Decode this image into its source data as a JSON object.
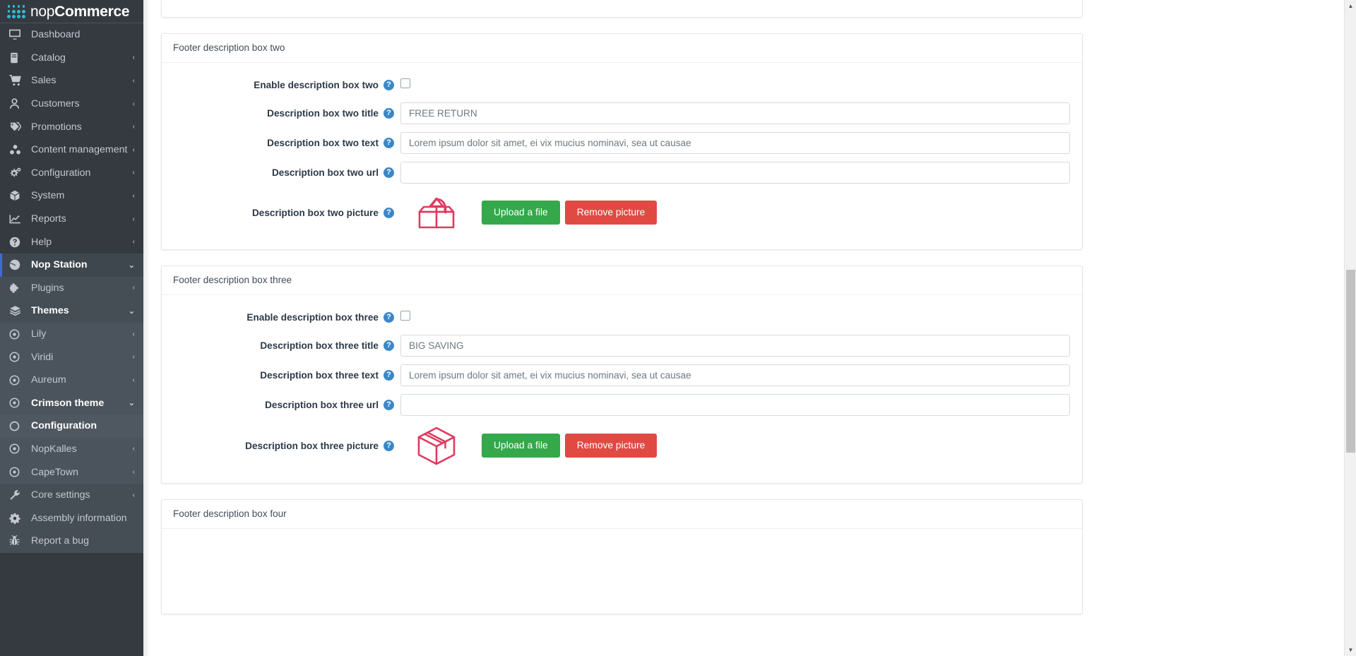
{
  "brand": {
    "name_light": "nop",
    "name_bold": "Commerce"
  },
  "sidebar": {
    "items": [
      {
        "label": "Dashboard",
        "icon": "dashboard-icon",
        "chevron": "",
        "level": 1,
        "state": "normal"
      },
      {
        "label": "Catalog",
        "icon": "catalog-icon",
        "chevron": "‹",
        "level": 1,
        "state": "normal"
      },
      {
        "label": "Sales",
        "icon": "cart-icon",
        "chevron": "‹",
        "level": 1,
        "state": "normal"
      },
      {
        "label": "Customers",
        "icon": "user-icon",
        "chevron": "‹",
        "level": 1,
        "state": "normal"
      },
      {
        "label": "Promotions",
        "icon": "tag-icon",
        "chevron": "‹",
        "level": 1,
        "state": "normal"
      },
      {
        "label": "Content management",
        "icon": "content-icon",
        "chevron": "‹",
        "level": 1,
        "state": "normal"
      },
      {
        "label": "Configuration",
        "icon": "gears-icon",
        "chevron": "‹",
        "level": 1,
        "state": "normal"
      },
      {
        "label": "System",
        "icon": "cube-icon",
        "chevron": "‹",
        "level": 1,
        "state": "normal"
      },
      {
        "label": "Reports",
        "icon": "chart-icon",
        "chevron": "‹",
        "level": 1,
        "state": "normal"
      },
      {
        "label": "Help",
        "icon": "question-circle-icon",
        "chevron": "‹",
        "level": 1,
        "state": "normal"
      },
      {
        "label": "Nop Station",
        "icon": "nopstation-icon",
        "chevron": "⌄",
        "level": 1,
        "state": "active-parent"
      },
      {
        "label": "Plugins",
        "icon": "puzzle-icon",
        "chevron": "‹",
        "level": 2,
        "state": "normal"
      },
      {
        "label": "Themes",
        "icon": "layers-icon",
        "chevron": "⌄",
        "level": 2,
        "state": "bold"
      },
      {
        "label": "Lily",
        "icon": "dot-circle-icon",
        "chevron": "‹",
        "level": 3,
        "state": "normal"
      },
      {
        "label": "Viridi",
        "icon": "dot-circle-icon",
        "chevron": "‹",
        "level": 3,
        "state": "normal"
      },
      {
        "label": "Aureum",
        "icon": "dot-circle-icon",
        "chevron": "‹",
        "level": 3,
        "state": "normal"
      },
      {
        "label": "Crimson theme",
        "icon": "dot-circle-icon",
        "chevron": "⌄",
        "level": 3,
        "state": "bold"
      },
      {
        "label": "Configuration",
        "icon": "circle-icon",
        "chevron": "",
        "level": 3,
        "state": "current"
      },
      {
        "label": "NopKalles",
        "icon": "dot-circle-icon",
        "chevron": "‹",
        "level": 3,
        "state": "normal"
      },
      {
        "label": "CapeTown",
        "icon": "dot-circle-icon",
        "chevron": "‹",
        "level": 3,
        "state": "normal"
      },
      {
        "label": "Core settings",
        "icon": "wrench-icon",
        "chevron": "‹",
        "level": 2,
        "state": "normal"
      },
      {
        "label": "Assembly information",
        "icon": "cog-icon",
        "chevron": "",
        "level": 2,
        "state": "normal"
      },
      {
        "label": "Report a bug",
        "icon": "bug-icon",
        "chevron": "",
        "level": 2,
        "state": "normal"
      }
    ]
  },
  "panels": [
    {
      "title": "Footer description box two",
      "enable_label": "Enable description box two",
      "enable_checked": false,
      "title_label": "Description box two title",
      "title_value": "FREE RETURN",
      "text_label": "Description box two text",
      "text_value": "Lorem ipsum dolor sit amet, ei vix mucius nominavi, sea ut causae",
      "url_label": "Description box two url",
      "url_value": "",
      "picture_label": "Description box two picture",
      "picture_icon": "open-box-with-arrow-icon",
      "upload_label": "Upload a file",
      "remove_label": "Remove picture"
    },
    {
      "title": "Footer description box three",
      "enable_label": "Enable description box three",
      "enable_checked": false,
      "title_label": "Description box three title",
      "title_value": "BIG SAVING",
      "text_label": "Description box three text",
      "text_value": "Lorem ipsum dolor sit amet, ei vix mucius nominavi, sea ut causae",
      "url_label": "Description box three url",
      "url_value": "",
      "picture_label": "Description box three picture",
      "picture_icon": "closed-box-icon",
      "upload_label": "Upload a file",
      "remove_label": "Remove picture"
    },
    {
      "title": "Footer description box four",
      "enable_label": "",
      "enable_checked": false,
      "title_label": "",
      "title_value": "",
      "text_label": "",
      "text_value": "",
      "url_label": "",
      "url_value": "",
      "picture_label": "",
      "picture_icon": "",
      "upload_label": "",
      "remove_label": ""
    }
  ],
  "colors": {
    "sidebar_bg": "#343a40",
    "accent_blue": "#3a87c8",
    "upload_green": "#34a84b",
    "remove_red": "#e04a43",
    "crimson": "#e03a5f",
    "active_bar": "#3f6ad8"
  },
  "scrollbar": {
    "up_arrow": "▲",
    "down_arrow": "▼"
  }
}
